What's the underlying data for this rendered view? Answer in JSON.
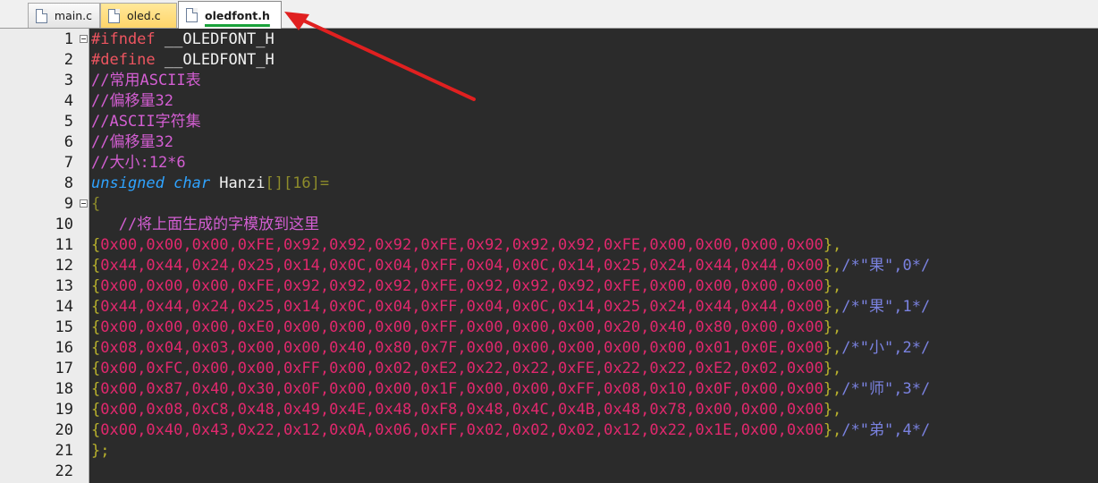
{
  "tabs": [
    {
      "label": "main.c",
      "active": false,
      "color": "#e8e8e8"
    },
    {
      "label": "oled.c",
      "active": false,
      "color": "#ffd76e"
    },
    {
      "label": "oledfont.h",
      "active": true,
      "color": "#ffffff"
    }
  ],
  "editor": {
    "lines": [
      {
        "num": "1",
        "parts": [
          {
            "c": "c-pre",
            "t": "#ifndef "
          },
          {
            "c": "c-white",
            "t": "__OLEDFONT_H"
          }
        ],
        "fold": true
      },
      {
        "num": "2",
        "parts": [
          {
            "c": "c-pre",
            "t": "#define "
          },
          {
            "c": "c-white",
            "t": "__OLEDFONT_H"
          }
        ]
      },
      {
        "num": "3",
        "parts": [
          {
            "c": "c-com",
            "t": "//常用ASCII表"
          }
        ]
      },
      {
        "num": "4",
        "parts": [
          {
            "c": "c-com",
            "t": "//偏移量32"
          }
        ]
      },
      {
        "num": "5",
        "parts": [
          {
            "c": "c-com",
            "t": "//ASCII字符集"
          }
        ]
      },
      {
        "num": "6",
        "parts": [
          {
            "c": "c-com",
            "t": "//偏移量32"
          }
        ]
      },
      {
        "num": "7",
        "parts": [
          {
            "c": "c-com",
            "t": "//大小:12*6"
          }
        ]
      },
      {
        "num": "8",
        "parts": [
          {
            "c": "c-kw",
            "t": "unsigned char"
          },
          {
            "c": "c-white",
            "t": " Hanzi"
          },
          {
            "c": "c-brk",
            "t": "[][16]="
          }
        ]
      },
      {
        "num": "9",
        "parts": [
          {
            "c": "c-brk",
            "t": "{"
          }
        ],
        "fold": true
      },
      {
        "num": "10",
        "parts": [
          {
            "c": "c-com",
            "t": "   //将上面生成的字模放到这里"
          }
        ]
      },
      {
        "num": "11",
        "parts": [
          {
            "c": "c-blk",
            "t": "{"
          },
          {
            "c": "c-hex",
            "t": "0x00,0x00,0x00,0xFE,0x92,0x92,0x92,0xFE,0x92,0x92,0x92,0xFE,0x00,0x00,0x00,0x00"
          },
          {
            "c": "c-blk",
            "t": "},"
          }
        ]
      },
      {
        "num": "12",
        "parts": [
          {
            "c": "c-blk",
            "t": "{"
          },
          {
            "c": "c-hex",
            "t": "0x44,0x44,0x24,0x25,0x14,0x0C,0x04,0xFF,0x04,0x0C,0x14,0x25,0x24,0x44,0x44,0x00"
          },
          {
            "c": "c-blk",
            "t": "},"
          },
          {
            "c": "c-tail",
            "t": "/*\"果\",0*/"
          }
        ]
      },
      {
        "num": "13",
        "parts": [
          {
            "c": "c-blk",
            "t": "{"
          },
          {
            "c": "c-hex",
            "t": "0x00,0x00,0x00,0xFE,0x92,0x92,0x92,0xFE,0x92,0x92,0x92,0xFE,0x00,0x00,0x00,0x00"
          },
          {
            "c": "c-blk",
            "t": "},"
          }
        ]
      },
      {
        "num": "14",
        "parts": [
          {
            "c": "c-blk",
            "t": "{"
          },
          {
            "c": "c-hex",
            "t": "0x44,0x44,0x24,0x25,0x14,0x0C,0x04,0xFF,0x04,0x0C,0x14,0x25,0x24,0x44,0x44,0x00"
          },
          {
            "c": "c-blk",
            "t": "},"
          },
          {
            "c": "c-tail",
            "t": "/*\"果\",1*/"
          }
        ]
      },
      {
        "num": "15",
        "parts": [
          {
            "c": "c-blk",
            "t": "{"
          },
          {
            "c": "c-hex",
            "t": "0x00,0x00,0x00,0xE0,0x00,0x00,0x00,0xFF,0x00,0x00,0x00,0x20,0x40,0x80,0x00,0x00"
          },
          {
            "c": "c-blk",
            "t": "},"
          }
        ]
      },
      {
        "num": "16",
        "parts": [
          {
            "c": "c-blk",
            "t": "{"
          },
          {
            "c": "c-hex",
            "t": "0x08,0x04,0x03,0x00,0x00,0x40,0x80,0x7F,0x00,0x00,0x00,0x00,0x00,0x01,0x0E,0x00"
          },
          {
            "c": "c-blk",
            "t": "},"
          },
          {
            "c": "c-tail",
            "t": "/*\"小\",2*/"
          }
        ]
      },
      {
        "num": "17",
        "parts": [
          {
            "c": "c-blk",
            "t": "{"
          },
          {
            "c": "c-hex",
            "t": "0x00,0xFC,0x00,0x00,0xFF,0x00,0x02,0xE2,0x22,0x22,0xFE,0x22,0x22,0xE2,0x02,0x00"
          },
          {
            "c": "c-blk",
            "t": "},"
          }
        ]
      },
      {
        "num": "18",
        "parts": [
          {
            "c": "c-blk",
            "t": "{"
          },
          {
            "c": "c-hex",
            "t": "0x00,0x87,0x40,0x30,0x0F,0x00,0x00,0x1F,0x00,0x00,0xFF,0x08,0x10,0x0F,0x00,0x00"
          },
          {
            "c": "c-blk",
            "t": "},"
          },
          {
            "c": "c-tail",
            "t": "/*\"师\",3*/"
          }
        ]
      },
      {
        "num": "19",
        "parts": [
          {
            "c": "c-blk",
            "t": "{"
          },
          {
            "c": "c-hex",
            "t": "0x00,0x08,0xC8,0x48,0x49,0x4E,0x48,0xF8,0x48,0x4C,0x4B,0x48,0x78,0x00,0x00,0x00"
          },
          {
            "c": "c-blk",
            "t": "},"
          }
        ]
      },
      {
        "num": "20",
        "parts": [
          {
            "c": "c-blk",
            "t": "{"
          },
          {
            "c": "c-hex",
            "t": "0x00,0x40,0x43,0x22,0x12,0x0A,0x06,0xFF,0x02,0x02,0x02,0x12,0x22,0x1E,0x00,0x00"
          },
          {
            "c": "c-blk",
            "t": "},"
          },
          {
            "c": "c-tail",
            "t": "/*\"弟\",4*/"
          }
        ]
      },
      {
        "num": "21",
        "parts": [
          {
            "c": "c-blk",
            "t": "};"
          }
        ]
      },
      {
        "num": "22",
        "parts": []
      }
    ]
  },
  "annotation": {
    "arrow_color": "#e02020"
  }
}
